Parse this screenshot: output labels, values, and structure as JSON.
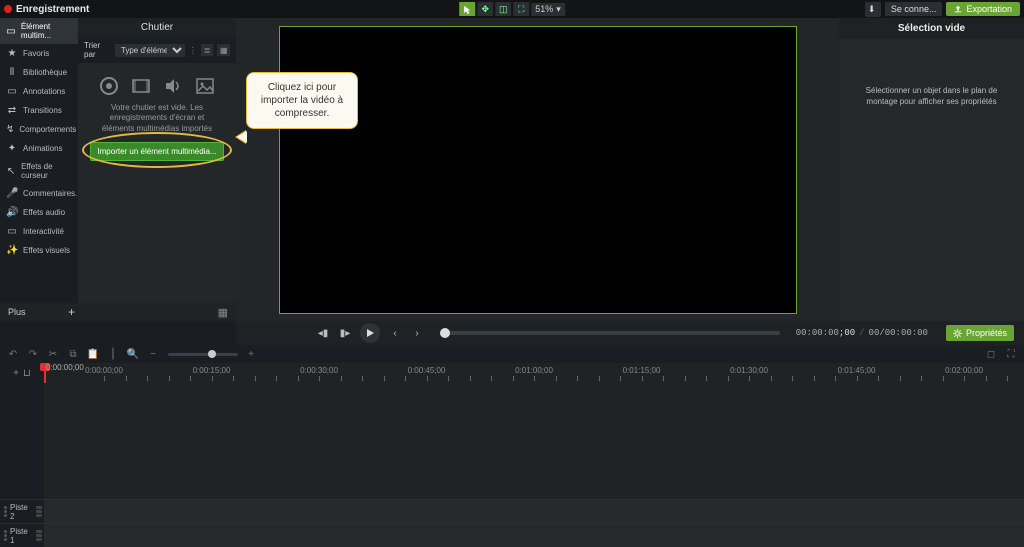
{
  "topbar": {
    "record_label": "Enregistrement",
    "zoom": "51%",
    "signin": "Se conne...",
    "export": "Exportation"
  },
  "sidebar": {
    "items": [
      {
        "label": "Élément multim...",
        "icon": "▭"
      },
      {
        "label": "Favoris",
        "icon": "★"
      },
      {
        "label": "Bibliothèque",
        "icon": "⫴"
      },
      {
        "label": "Annotations",
        "icon": "▭"
      },
      {
        "label": "Transitions",
        "icon": "⇄"
      },
      {
        "label": "Comportements",
        "icon": "↯"
      },
      {
        "label": "Animations",
        "icon": "✦"
      },
      {
        "label": "Effets de curseur",
        "icon": "↖"
      },
      {
        "label": "Commentaires...",
        "icon": "🎤"
      },
      {
        "label": "Effets audio",
        "icon": "🔊"
      },
      {
        "label": "Interactivité",
        "icon": "▭"
      },
      {
        "label": "Effets visuels",
        "icon": "✨"
      }
    ]
  },
  "bin": {
    "title": "Chutier",
    "sort_label": "Trier par",
    "sort_value": "Type d'élément mult...",
    "empty_line1": "Votre chutier est vide. Les",
    "empty_line2": "enregistrements d'écran et",
    "empty_line3": "éléments multimédias importés",
    "import_btn": "Importer un élément multimédia..."
  },
  "callout": {
    "text": "Cliquez ici pour importer la vidéo à compresser."
  },
  "plusrow": {
    "label": "Plus",
    "plus": "+"
  },
  "properties": {
    "title": "Sélection vide",
    "placeholder": "Sélectionner un objet dans le plan de montage pour afficher ses propriétés"
  },
  "playback": {
    "time_current": "00:00:00",
    "time_frames": "00",
    "time_total": "00/00:00:00",
    "properties_btn": "Propriétés"
  },
  "timeline": {
    "playhead_time": "0:00:00;00",
    "labels": [
      "0:00:00;00",
      "0:00:15;00",
      "0:00:30;00",
      "0:00:45;00",
      "0:01:00;00",
      "0:01:15;00",
      "0:01:30;00",
      "0:01:45;00",
      "0:02:00;00"
    ],
    "tracks": [
      {
        "name": "Piste 2"
      },
      {
        "name": "Piste 1"
      }
    ]
  }
}
